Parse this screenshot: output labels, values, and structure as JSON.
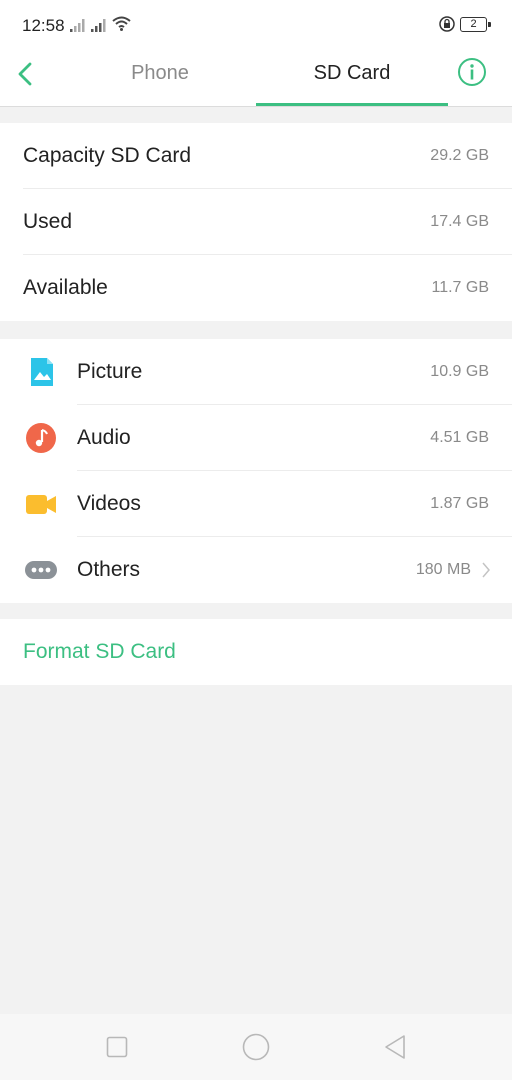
{
  "status": {
    "time": "12:58",
    "battery": "2"
  },
  "header": {
    "tabs": [
      {
        "label": "Phone",
        "active": false
      },
      {
        "label": "SD Card",
        "active": true
      }
    ],
    "accent_color": "#3cbf82"
  },
  "storage": {
    "rows": [
      {
        "label": "Capacity SD Card",
        "value": "29.2 GB"
      },
      {
        "label": "Used",
        "value": "17.4 GB"
      },
      {
        "label": "Available",
        "value": "11.7 GB"
      }
    ]
  },
  "categories": [
    {
      "icon": "picture-icon",
      "label": "Picture",
      "value": "10.9 GB",
      "color": "#2cc4e8"
    },
    {
      "icon": "audio-icon",
      "label": "Audio",
      "value": "4.51 GB",
      "color": "#f0674a"
    },
    {
      "icon": "video-icon",
      "label": "Videos",
      "value": "1.87 GB",
      "color": "#fbbd2e"
    },
    {
      "icon": "others-icon",
      "label": "Others",
      "value": "180 MB",
      "color": "#8b9197"
    }
  ],
  "actions": {
    "format_label": "Format SD Card"
  }
}
